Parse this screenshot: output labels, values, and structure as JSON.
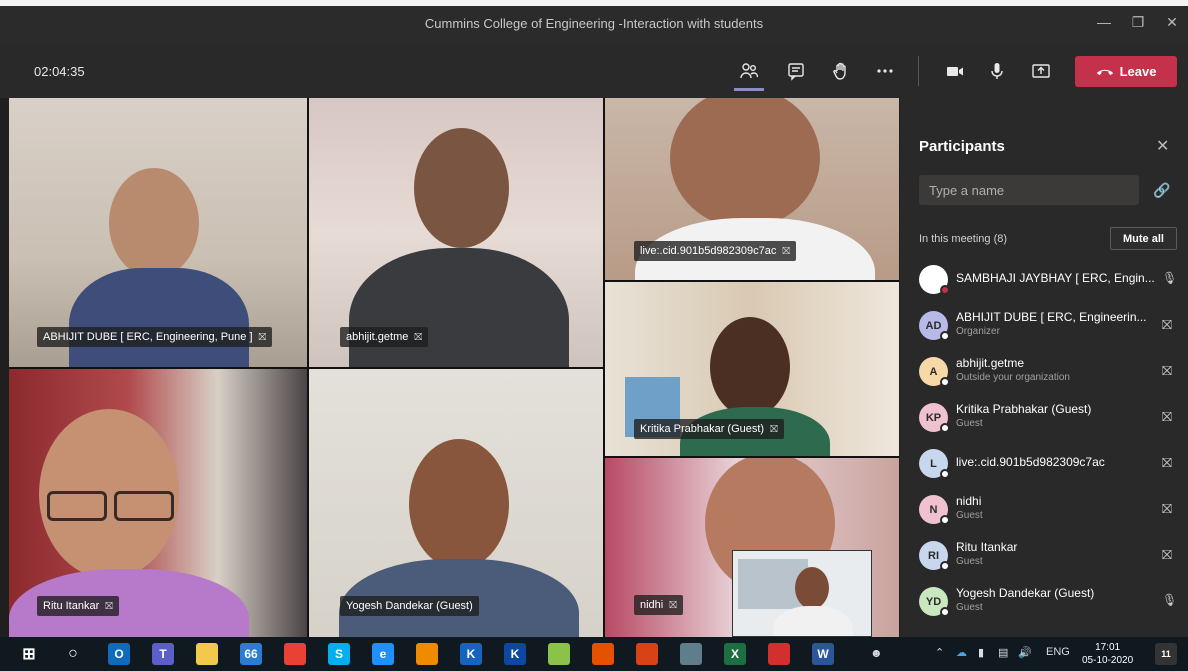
{
  "window": {
    "title": "Cummins College of Engineering -Interaction with students"
  },
  "toolbar": {
    "timer": "02:04:35",
    "leave_label": "Leave"
  },
  "video_tiles": [
    {
      "name": "ABHIJIT DUBE [ ERC, Engineering, Pune ]"
    },
    {
      "name": "abhijit.getme"
    },
    {
      "name": "live:.cid.901b5d982309c7ac"
    },
    {
      "name": "Kritika Prabhakar (Guest)"
    },
    {
      "name": "Ritu Itankar"
    },
    {
      "name": "Yogesh Dandekar (Guest)"
    },
    {
      "name": "nidhi"
    }
  ],
  "panel": {
    "title": "Participants",
    "search_placeholder": "Type a name",
    "in_meeting_label": "In this meeting (8)",
    "mute_all_label": "Mute all",
    "participants": [
      {
        "initials": "",
        "name": "SAMBHAJI JAYBHAY [ ERC, Engin...",
        "role": "",
        "avatar_color": "#ffffff",
        "mic": "on"
      },
      {
        "initials": "AD",
        "name": "ABHIJIT DUBE [ ERC, Engineerin...",
        "role": "Organizer",
        "avatar_color": "#b7b9e8",
        "mic": "muted"
      },
      {
        "initials": "A",
        "name": "abhijit.getme",
        "role": "Outside your organization",
        "avatar_color": "#f7d9a8",
        "mic": "muted"
      },
      {
        "initials": "KP",
        "name": "Kritika Prabhakar (Guest)",
        "role": "Guest",
        "avatar_color": "#f0c2d0",
        "mic": "muted"
      },
      {
        "initials": "L",
        "name": "live:.cid.901b5d982309c7ac",
        "role": "",
        "avatar_color": "#c7d7ee",
        "mic": "muted"
      },
      {
        "initials": "N",
        "name": "nidhi",
        "role": "Guest",
        "avatar_color": "#f0c2d0",
        "mic": "muted"
      },
      {
        "initials": "RI",
        "name": "Ritu Itankar",
        "role": "Guest",
        "avatar_color": "#c7d7ee",
        "mic": "muted"
      },
      {
        "initials": "YD",
        "name": "Yogesh Dandekar (Guest)",
        "role": "Guest",
        "avatar_color": "#c9e8c0",
        "mic": "on"
      }
    ]
  },
  "taskbar": {
    "apps": [
      {
        "icon": "outlook-icon",
        "label": "O",
        "color": "#0f6cbd"
      },
      {
        "icon": "teams-icon",
        "label": "T",
        "color": "#5b5fc7"
      },
      {
        "icon": "file-explorer-icon",
        "label": "",
        "color": "#f2c94c"
      },
      {
        "icon": "mail-icon",
        "label": "66",
        "color": "#2b7cd3"
      },
      {
        "icon": "chrome-icon",
        "label": "",
        "color": "#e94235"
      },
      {
        "icon": "skype-icon",
        "label": "S",
        "color": "#00aff0"
      },
      {
        "icon": "ie-icon",
        "label": "e",
        "color": "#1e90ff"
      },
      {
        "icon": "vlc-icon",
        "label": "",
        "color": "#f08a00"
      },
      {
        "icon": "k-app-icon",
        "label": "K",
        "color": "#1565c0"
      },
      {
        "icon": "k-app-2-icon",
        "label": "K",
        "color": "#0d47a1"
      },
      {
        "icon": "app-icon",
        "label": "",
        "color": "#8bc34a"
      },
      {
        "icon": "matlab-icon",
        "label": "",
        "color": "#e65100"
      },
      {
        "icon": "shield-app-icon",
        "label": "",
        "color": "#d84315"
      },
      {
        "icon": "calculator-icon",
        "label": "",
        "color": "#607d8b"
      },
      {
        "icon": "excel-icon",
        "label": "X",
        "color": "#1d6f42"
      },
      {
        "icon": "acrobat-icon",
        "label": "",
        "color": "#d32f2f"
      },
      {
        "icon": "word-icon",
        "label": "W",
        "color": "#2b579a"
      }
    ],
    "language": "ENG",
    "time": "17:01",
    "date": "05-10-2020",
    "notification_count": "11"
  }
}
